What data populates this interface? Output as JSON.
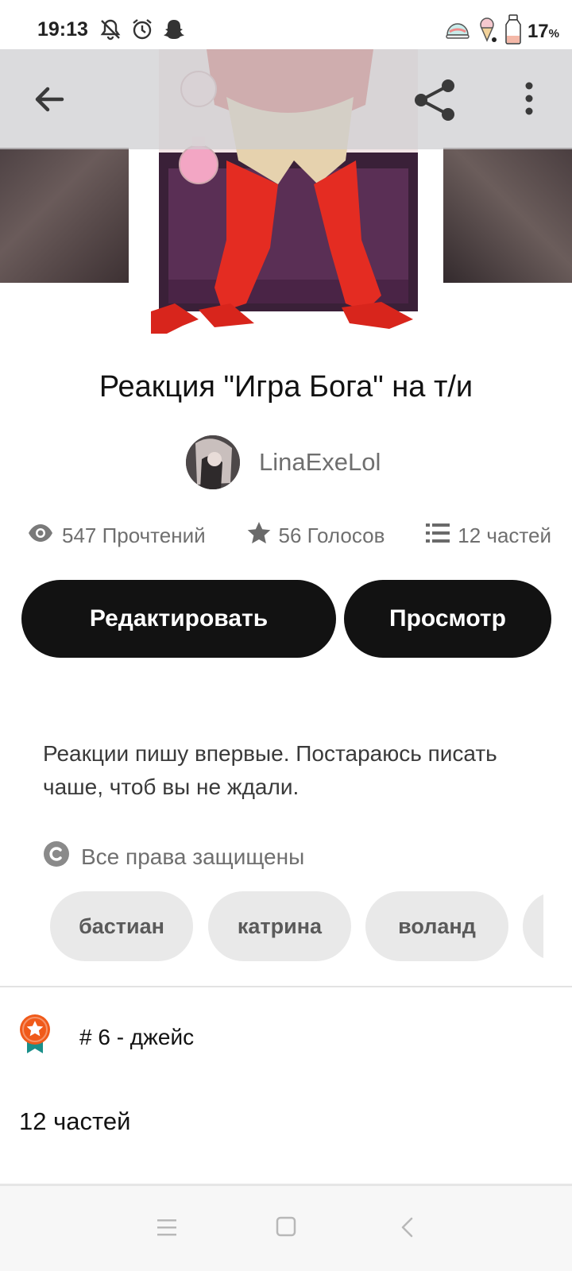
{
  "status_bar": {
    "time": "19:13",
    "left_icons": [
      "notifications-off-icon",
      "alarm-icon",
      "snapchat-icon"
    ],
    "right_icons": [
      "sushi-icon",
      "ice-cream-icon",
      "milk-bottle-icon"
    ],
    "battery_value": "17",
    "battery_unit": "%"
  },
  "app_bar": {
    "back_icon": "arrow-back-icon",
    "share_icon": "share-icon",
    "more_icon": "more-vertical-icon"
  },
  "story": {
    "title": "Реакция \"Игра Бога\" на т/и",
    "author": "LinaExeLol",
    "stats": {
      "reads": "547 Прочтений",
      "votes": "56 Голосов",
      "parts": "12 частей"
    },
    "edit_label": "Редактировать",
    "view_label": "Просмотр",
    "description": "Реакции пишу впервые. Постараюсь писать чаше, чтоб вы не ждали.",
    "copyright": "Все права защищены",
    "tags": [
      "бастиан",
      "катрина",
      "воланд",
      ""
    ],
    "rank": "# 6 - джейс",
    "parts_heading": "12 частей"
  },
  "colors": {
    "primary_button": "#121212",
    "tag_background": "#e9e9e9",
    "rank_badge": "#f05a1a",
    "rank_ribbon": "#1a8f8a"
  },
  "nav_bar": {
    "icons": [
      "menu-icon",
      "home-square-icon",
      "back-chevron-icon"
    ]
  }
}
